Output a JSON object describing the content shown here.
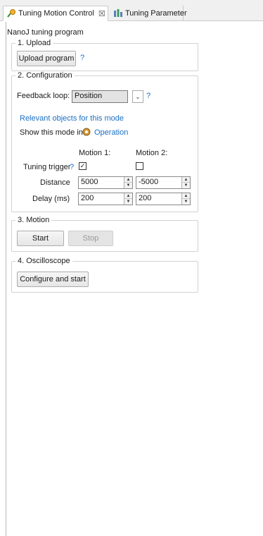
{
  "tabs": [
    {
      "label": "Tuning Motion Control",
      "close": "☒"
    },
    {
      "label": "Tuning Parameter"
    }
  ],
  "program": {
    "title": "NanoJ tuning program"
  },
  "upload": {
    "legend": "1. Upload",
    "button": "Upload program",
    "help": "?"
  },
  "configuration": {
    "legend": "2. Configuration",
    "feedback_label": "Feedback loop:",
    "feedback_value": "Position",
    "feedback_help": "?",
    "relevant_link": "Relevant objects for this mode",
    "show_mode_label": "Show this mode in",
    "operation_link": "Operation",
    "motion1_header": "Motion 1:",
    "motion2_header": "Motion 2:",
    "trigger_label": "Tuning trigger",
    "trigger_help": "?",
    "trigger_checked_glyph": "✓",
    "distance_label": "Distance",
    "distance_m1": "5000",
    "distance_m2": "-5000",
    "delay_label": "Delay (ms)",
    "delay_m1": "200",
    "delay_m2": "200"
  },
  "motion": {
    "legend": "3. Motion",
    "start": "Start",
    "stop": "Stop"
  },
  "oscilloscope": {
    "legend": "4. Oscilloscope",
    "button": "Configure and start"
  },
  "colors": {
    "link": "#1a6fc4",
    "tab_bg": "#f0f0f0"
  }
}
